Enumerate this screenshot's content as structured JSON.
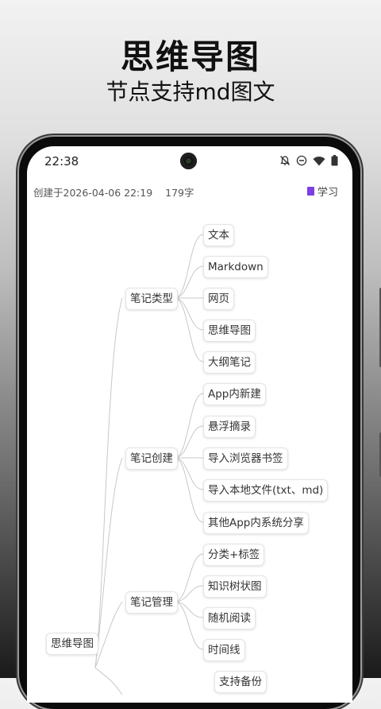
{
  "promo": {
    "title": "思维导图",
    "subtitle": "节点支持md图文"
  },
  "status_bar": {
    "time": "22:38",
    "icons": [
      "bell-off-icon",
      "dnd-icon",
      "wifi-icon",
      "battery-icon"
    ]
  },
  "note_meta": {
    "created": "创建于2026-04-06 22:19",
    "word_count": "179字",
    "notebook": "学习",
    "notebook_color": "#7b3fe4"
  },
  "mindmap": {
    "root": "思维导图",
    "branches": [
      {
        "label": "笔记类型",
        "children": [
          "文本",
          "Markdown",
          "网页",
          "思维导图",
          "大纲笔记"
        ]
      },
      {
        "label": "笔记创建",
        "children": [
          "App内新建",
          "悬浮摘录",
          "导入浏览器书签",
          "导入本地文件(txt、md)",
          "其他App内系统分享"
        ]
      },
      {
        "label": "笔记管理",
        "children": [
          "分类+标签",
          "知识树状图",
          "随机阅读",
          "时间线",
          "支持备份"
        ]
      }
    ]
  }
}
